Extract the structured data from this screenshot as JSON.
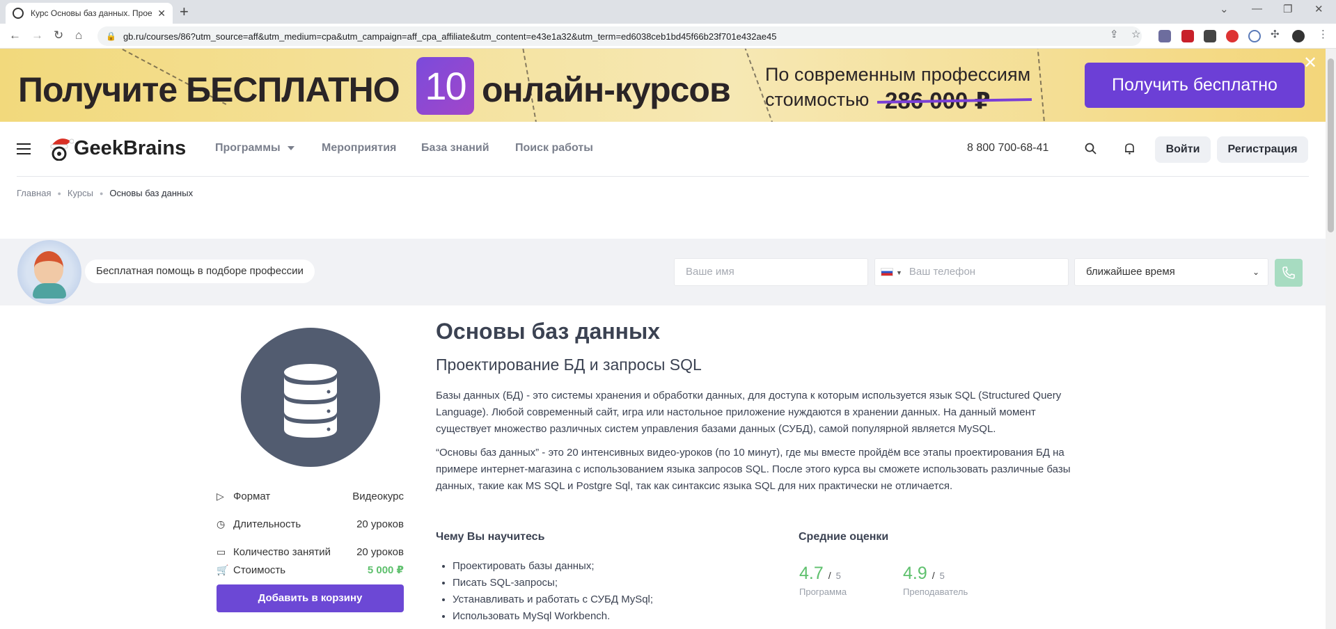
{
  "browser": {
    "tab_title": "Курс Основы баз данных. Прое",
    "url": "gb.ru/courses/86?utm_source=aff&utm_medium=cpa&utm_campaign=aff_cpa_affiliate&utm_content=e43e1a32&utm_term=ed6038ceb1bd45f66b23f701e432ae45",
    "new_tab_symbol": "+",
    "close_symbol": "✕"
  },
  "banner": {
    "headline_left": "Получите БЕСПЛАТНО",
    "headline_number": "10",
    "headline_right": "онлайн-курсов",
    "sub_line1": "По современным профессиям",
    "sub_line2": "стоимостью",
    "old_price": "286 000 ₽",
    "cta": "Получить бесплатно",
    "close": "✕"
  },
  "header": {
    "logo": "GeekBrains",
    "nav": [
      "Программы",
      "Мероприятия",
      "База знаний",
      "Поиск работы"
    ],
    "phone": "8 800 700-68-41",
    "login": "Войти",
    "register": "Регистрация"
  },
  "breadcrumb": [
    "Главная",
    "Курсы",
    "Основы баз данных"
  ],
  "help": {
    "label": "Бесплатная помощь в подборе профессии",
    "name_placeholder": "Ваше имя",
    "phone_placeholder": "Ваш телефон",
    "time_value": "ближайшее время"
  },
  "course": {
    "title": "Основы баз данных",
    "subtitle": "Проектирование БД и запросы SQL",
    "desc1": "Базы данных (БД) - это системы хранения и обработки данных, для доступа к которым используется язык SQL (Structured Query Language). Любой современный сайт, игра или настольное приложение нуждаются в хранении данных. На данный момент существует множество различных систем управления базами данных (СУБД), самой популярной является MySQL.",
    "desc2": "“Основы баз данных” - это 20 интенсивных видео-уроков (по 10 минут), где мы вместе пройдём все этапы проектирования БД на примере интернет-магазина с использованием языка запросов SQL. После этого курса вы сможете использовать различные базы данных, такие как MS SQL и Postgre Sql, так как синтаксис языка SQL для них практически не отличается.",
    "meta": [
      {
        "label": "Формат",
        "value": "Видеокурс",
        "icon": "play-icon"
      },
      {
        "label": "Длительность",
        "value": "20 уроков",
        "icon": "clock-icon"
      },
      {
        "label": "Количество занятий",
        "value": "20 уроков",
        "icon": "monitor-icon"
      },
      {
        "label": "Стоимость",
        "value": "5 000 ₽",
        "icon": "cart-icon"
      }
    ],
    "cart_button": "Добавить в корзину",
    "learn_title": "Чему Вы научитесь",
    "learn_items": [
      "Проектировать базы данных;",
      "Писать SQL-запросы;",
      "Устанавливать и работать с СУБД MySql;",
      "Использовать MySql Workbench."
    ],
    "ratings_title": "Средние оценки",
    "ratings": [
      {
        "value": "4.7",
        "slash": "/",
        "of": "5",
        "label": "Программа"
      },
      {
        "value": "4.9",
        "slash": "/",
        "of": "5",
        "label": "Преподаватель"
      }
    ]
  },
  "colors": {
    "accent": "#6c48d5",
    "price": "#5ec06d",
    "banner_bg": "#f2d97c"
  }
}
